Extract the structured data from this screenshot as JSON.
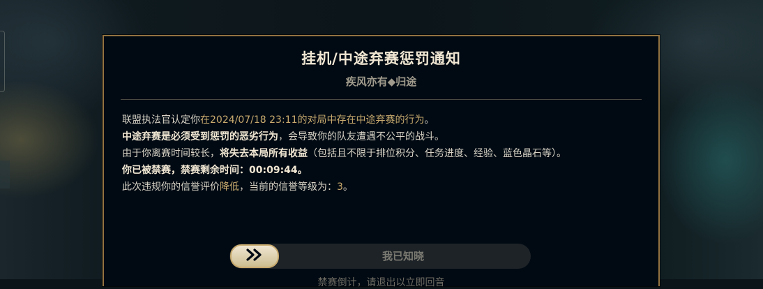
{
  "dialog": {
    "title": "挂机/中途弃赛惩罚通知",
    "subtitle": "疾风亦有◆归途",
    "lines": [
      {
        "a": "联盟执法官认定你",
        "b": "在2024/07/18 23:11的对局中存在中途弃赛的行为",
        "c": "。"
      },
      {
        "a": "中途弃赛是必须受到惩罚的恶劣行为",
        "b": "，会导致你的队友遭遇不公平的战斗。"
      },
      {
        "a": "由于你离赛时间较长，",
        "b": "将失去本局所有收益",
        "c": "（包括且不限于排位积分、任务进度、经验、蓝色晶石等）。"
      },
      {
        "a": "你已被禁赛，禁赛剩余时间：00:09:44。"
      },
      {
        "a": "此次违规你的信誉评价",
        "b": "降低",
        "c": "，当前的信誉等级为：",
        "d": "3",
        "e": "。"
      }
    ],
    "ack_label": "我已知晓",
    "footer": "禁赛倒计，请退出以立即回音"
  },
  "icons": {
    "ack_handle": "double-chevron-right-icon"
  },
  "colors": {
    "gold": "#c8aa6e",
    "border": "#937341",
    "title": "#f0e6d2"
  }
}
